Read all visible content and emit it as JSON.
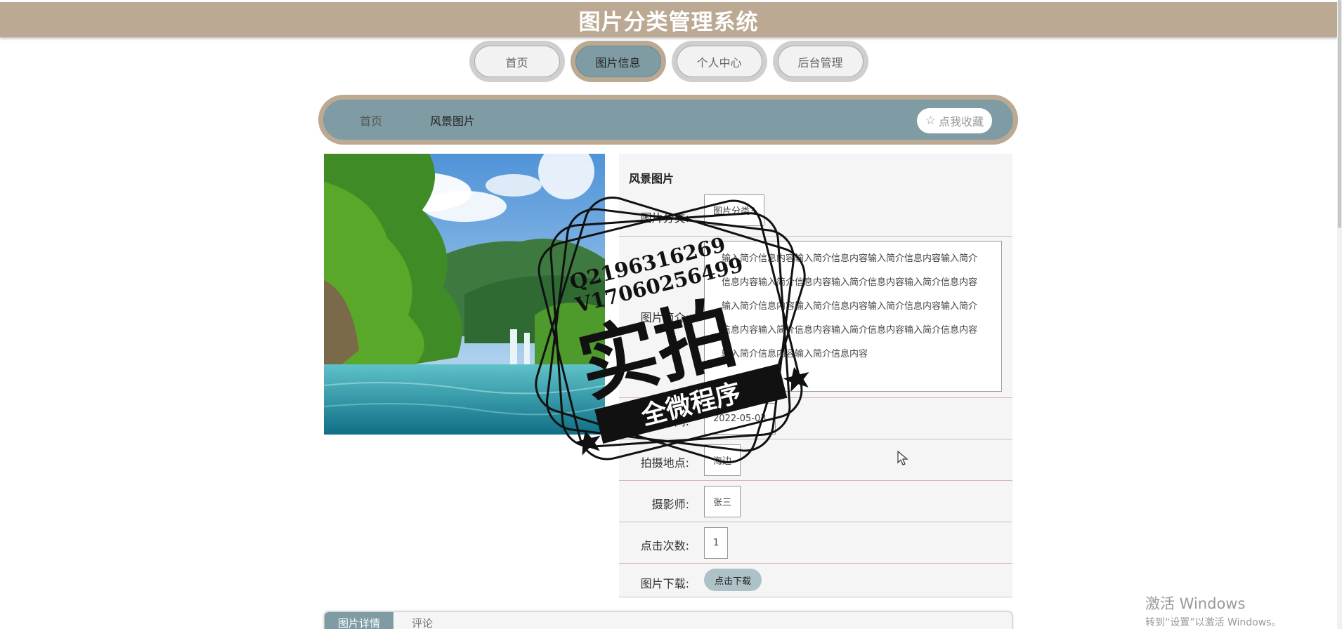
{
  "header": {
    "title": "图片分类管理系统"
  },
  "nav": [
    {
      "label": "首页",
      "active": false
    },
    {
      "label": "图片信息",
      "active": true
    },
    {
      "label": "个人中心",
      "active": false
    },
    {
      "label": "后台管理",
      "active": false
    }
  ],
  "breadcrumb": {
    "home": "首页",
    "current": "风景图片",
    "favorite_label": "点我收藏"
  },
  "detail": {
    "title": "风景图片",
    "fields": {
      "category": {
        "label": "图片分类:",
        "value": "图片分类3"
      },
      "description": {
        "label": "图片简介:",
        "value": "输入简介信息内容输入简介信息内容输入简介信息内容输入简介信息内容输入简介信息内容输入简介信息内容输入简介信息内容输入简介信息内容输入简介信息内容输入简介信息内容输入简介信息内容输入简介信息内容输入简介信息内容输入简介信息内容输入简介信息内容输入简介信息内容"
      },
      "shoot_time": {
        "label": "拍摄时间:",
        "value": "2022-05-03"
      },
      "location": {
        "label": "拍摄地点:",
        "value": "海边"
      },
      "photographer": {
        "label": "摄影师:",
        "value": "张三"
      },
      "clicks": {
        "label": "点击次数:",
        "value": "1"
      },
      "download": {
        "label": "图片下载:",
        "button": "点击下载"
      }
    }
  },
  "tabs": [
    {
      "label": "图片详情",
      "active": true
    },
    {
      "label": "评论",
      "active": false
    }
  ],
  "watermark": {
    "qq": "Q2196316269",
    "vx": "V17060256499",
    "main": "实拍",
    "ribbon": "全微程序"
  },
  "windows": {
    "line1": "激活 Windows",
    "line2": "转到“设置”以激活 Windows。"
  },
  "colors": {
    "header": "#bba993",
    "accent": "#7f9ba3",
    "panel": "#f5f5f5"
  }
}
